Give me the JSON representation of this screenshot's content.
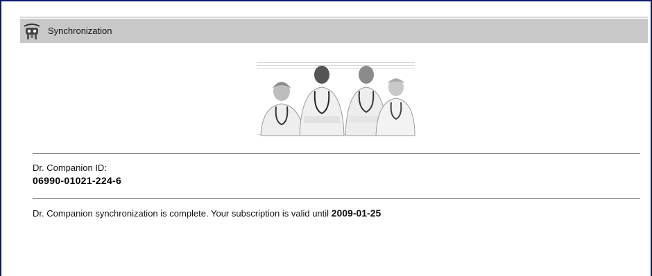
{
  "window": {
    "title": "Synchronization",
    "icon": "companion-robot-icon"
  },
  "hero": {
    "image": "doctors-group-illustration"
  },
  "account": {
    "id_label": "Dr. Companion ID:",
    "id_value": "06990-01021-224-6"
  },
  "status": {
    "message": "Dr. Companion synchronization is complete. Your subscription is valid until ",
    "valid_until": "2009-01-25"
  },
  "colors": {
    "frame_border": "#0a1a70",
    "titlebar_bg": "#c8c8c8"
  }
}
